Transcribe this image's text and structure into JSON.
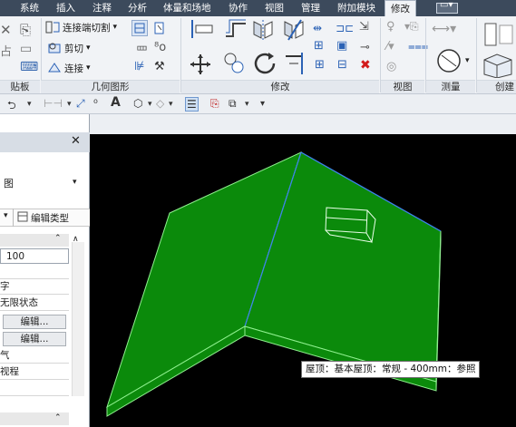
{
  "ribbon_tabs": [
    {
      "label": "系统"
    },
    {
      "label": "插入"
    },
    {
      "label": "注释"
    },
    {
      "label": "分析"
    },
    {
      "label": "体量和场地"
    },
    {
      "label": "协作"
    },
    {
      "label": "视图"
    },
    {
      "label": "管理"
    },
    {
      "label": "附加模块"
    },
    {
      "label": "修改"
    }
  ],
  "active_tab": "修改",
  "ribbon": {
    "clipboard_label": "贴板",
    "geometry": {
      "label": "几何图形",
      "join_label": "连接端切割",
      "cut_label": "剪切",
      "connect_label": "连接"
    },
    "modify_label": "修改",
    "view_label": "视图",
    "measure_label": "测量",
    "create_label": "创建"
  },
  "properties_panel": {
    "type_selector_text": "图",
    "edit_type_label": "编辑类型",
    "rows": [
      {
        "text": "100"
      },
      {
        "text": ""
      },
      {
        "text": "字"
      },
      {
        "text": "无限状态"
      },
      {
        "text": "编辑..."
      },
      {
        "text": "编辑..."
      },
      {
        "text": "气"
      },
      {
        "text": "视程"
      }
    ]
  },
  "viewport": {
    "tooltip": "屋顶：基本屋顶：常规 - 400mm：参照",
    "roof_color": "#0b8a0b",
    "background_color": "#000000"
  },
  "colors": {
    "tabbar_bg": "#3c4a5c",
    "ribbon_bg": "#f1f3f6",
    "accent_blue": "#1e5fb3"
  }
}
